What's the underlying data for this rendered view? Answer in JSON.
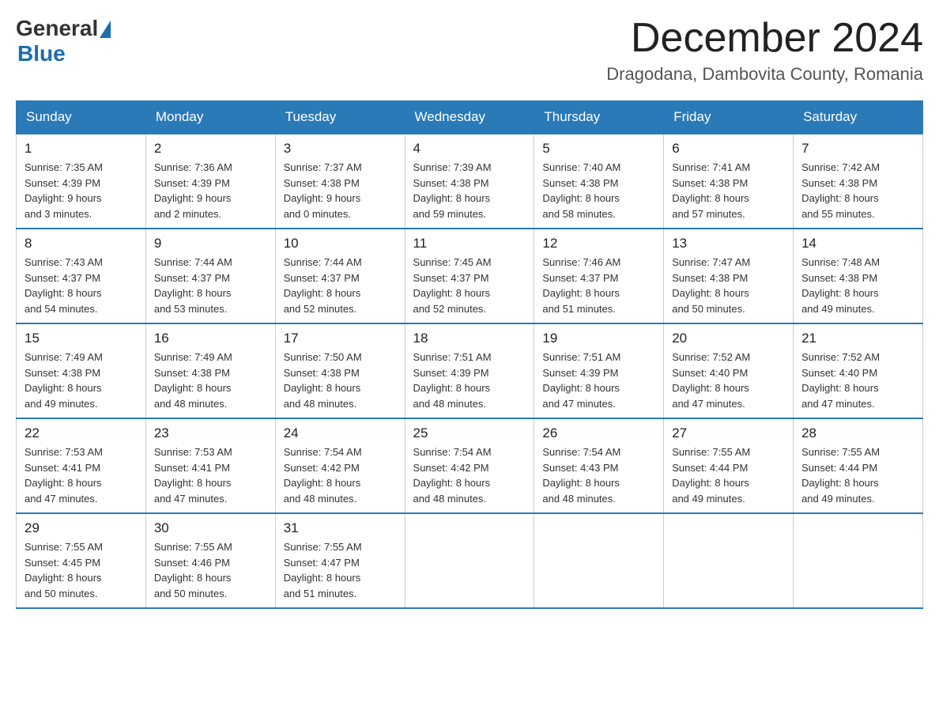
{
  "logo": {
    "general_text": "General",
    "blue_text": "Blue"
  },
  "title": "December 2024",
  "location": "Dragodana, Dambovita County, Romania",
  "days_of_week": [
    "Sunday",
    "Monday",
    "Tuesday",
    "Wednesday",
    "Thursday",
    "Friday",
    "Saturday"
  ],
  "weeks": [
    [
      {
        "day": "1",
        "sunrise": "7:35 AM",
        "sunset": "4:39 PM",
        "daylight": "9 hours and 3 minutes."
      },
      {
        "day": "2",
        "sunrise": "7:36 AM",
        "sunset": "4:39 PM",
        "daylight": "9 hours and 2 minutes."
      },
      {
        "day": "3",
        "sunrise": "7:37 AM",
        "sunset": "4:38 PM",
        "daylight": "9 hours and 0 minutes."
      },
      {
        "day": "4",
        "sunrise": "7:39 AM",
        "sunset": "4:38 PM",
        "daylight": "8 hours and 59 minutes."
      },
      {
        "day": "5",
        "sunrise": "7:40 AM",
        "sunset": "4:38 PM",
        "daylight": "8 hours and 58 minutes."
      },
      {
        "day": "6",
        "sunrise": "7:41 AM",
        "sunset": "4:38 PM",
        "daylight": "8 hours and 57 minutes."
      },
      {
        "day": "7",
        "sunrise": "7:42 AM",
        "sunset": "4:38 PM",
        "daylight": "8 hours and 55 minutes."
      }
    ],
    [
      {
        "day": "8",
        "sunrise": "7:43 AM",
        "sunset": "4:37 PM",
        "daylight": "8 hours and 54 minutes."
      },
      {
        "day": "9",
        "sunrise": "7:44 AM",
        "sunset": "4:37 PM",
        "daylight": "8 hours and 53 minutes."
      },
      {
        "day": "10",
        "sunrise": "7:44 AM",
        "sunset": "4:37 PM",
        "daylight": "8 hours and 52 minutes."
      },
      {
        "day": "11",
        "sunrise": "7:45 AM",
        "sunset": "4:37 PM",
        "daylight": "8 hours and 52 minutes."
      },
      {
        "day": "12",
        "sunrise": "7:46 AM",
        "sunset": "4:37 PM",
        "daylight": "8 hours and 51 minutes."
      },
      {
        "day": "13",
        "sunrise": "7:47 AM",
        "sunset": "4:38 PM",
        "daylight": "8 hours and 50 minutes."
      },
      {
        "day": "14",
        "sunrise": "7:48 AM",
        "sunset": "4:38 PM",
        "daylight": "8 hours and 49 minutes."
      }
    ],
    [
      {
        "day": "15",
        "sunrise": "7:49 AM",
        "sunset": "4:38 PM",
        "daylight": "8 hours and 49 minutes."
      },
      {
        "day": "16",
        "sunrise": "7:49 AM",
        "sunset": "4:38 PM",
        "daylight": "8 hours and 48 minutes."
      },
      {
        "day": "17",
        "sunrise": "7:50 AM",
        "sunset": "4:38 PM",
        "daylight": "8 hours and 48 minutes."
      },
      {
        "day": "18",
        "sunrise": "7:51 AM",
        "sunset": "4:39 PM",
        "daylight": "8 hours and 48 minutes."
      },
      {
        "day": "19",
        "sunrise": "7:51 AM",
        "sunset": "4:39 PM",
        "daylight": "8 hours and 47 minutes."
      },
      {
        "day": "20",
        "sunrise": "7:52 AM",
        "sunset": "4:40 PM",
        "daylight": "8 hours and 47 minutes."
      },
      {
        "day": "21",
        "sunrise": "7:52 AM",
        "sunset": "4:40 PM",
        "daylight": "8 hours and 47 minutes."
      }
    ],
    [
      {
        "day": "22",
        "sunrise": "7:53 AM",
        "sunset": "4:41 PM",
        "daylight": "8 hours and 47 minutes."
      },
      {
        "day": "23",
        "sunrise": "7:53 AM",
        "sunset": "4:41 PM",
        "daylight": "8 hours and 47 minutes."
      },
      {
        "day": "24",
        "sunrise": "7:54 AM",
        "sunset": "4:42 PM",
        "daylight": "8 hours and 48 minutes."
      },
      {
        "day": "25",
        "sunrise": "7:54 AM",
        "sunset": "4:42 PM",
        "daylight": "8 hours and 48 minutes."
      },
      {
        "day": "26",
        "sunrise": "7:54 AM",
        "sunset": "4:43 PM",
        "daylight": "8 hours and 48 minutes."
      },
      {
        "day": "27",
        "sunrise": "7:55 AM",
        "sunset": "4:44 PM",
        "daylight": "8 hours and 49 minutes."
      },
      {
        "day": "28",
        "sunrise": "7:55 AM",
        "sunset": "4:44 PM",
        "daylight": "8 hours and 49 minutes."
      }
    ],
    [
      {
        "day": "29",
        "sunrise": "7:55 AM",
        "sunset": "4:45 PM",
        "daylight": "8 hours and 50 minutes."
      },
      {
        "day": "30",
        "sunrise": "7:55 AM",
        "sunset": "4:46 PM",
        "daylight": "8 hours and 50 minutes."
      },
      {
        "day": "31",
        "sunrise": "7:55 AM",
        "sunset": "4:47 PM",
        "daylight": "8 hours and 51 minutes."
      },
      null,
      null,
      null,
      null
    ]
  ],
  "labels": {
    "sunrise_prefix": "Sunrise: ",
    "sunset_prefix": "Sunset: ",
    "daylight_prefix": "Daylight: "
  }
}
